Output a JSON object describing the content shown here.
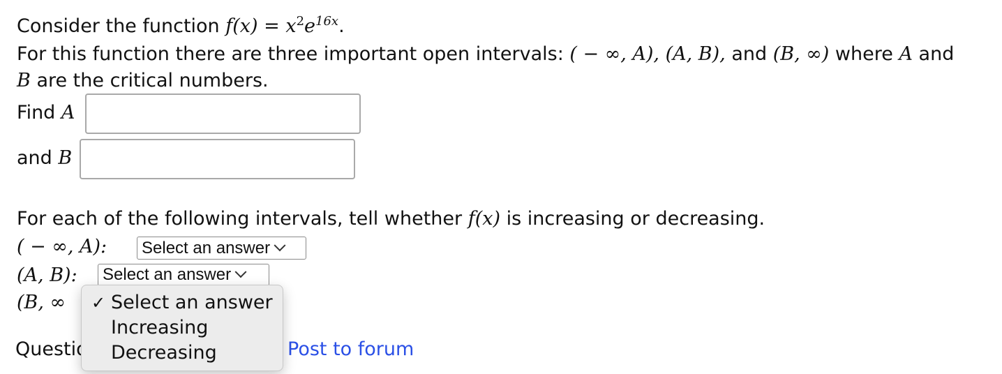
{
  "intro": {
    "prefix": "Consider the function",
    "fx": "f(x)",
    "eq": " = ",
    "base": "x",
    "exp1": "2",
    "e": "e",
    "exp2": "16x",
    "period": "."
  },
  "line2": {
    "text1": "For this function there are three important open intervals:",
    "int1": "( − ∞, A),",
    "int2": "(A, B),",
    "and": "and",
    "int3": "(B, ∞)",
    "where": "where",
    "A": "A",
    "and2": "and"
  },
  "line3": {
    "B": "B",
    "text": "are the critical numbers."
  },
  "find_a": {
    "label": "Find",
    "var": "A",
    "value": "",
    "placeholder": ""
  },
  "find_b": {
    "label": "and",
    "var": "B",
    "value": "",
    "placeholder": ""
  },
  "question": {
    "text1": "For each of the following intervals, tell whether",
    "fx": "f(x)",
    "text2": "is increasing or decreasing."
  },
  "rows": [
    {
      "interval": "( − ∞, A):",
      "selected": "Select an answer"
    },
    {
      "interval": "(A, B):",
      "selected": "Select an answer"
    },
    {
      "interval": "(B, ∞",
      "selected": ""
    }
  ],
  "dropdown": {
    "check": "✓",
    "options": [
      "Select an answer",
      "Increasing",
      "Decreasing"
    ]
  },
  "footer": {
    "label": "Questio",
    "post_link": "Post to forum"
  },
  "colors": {
    "link": "#2b50e6",
    "border": "#a9a9a9"
  }
}
